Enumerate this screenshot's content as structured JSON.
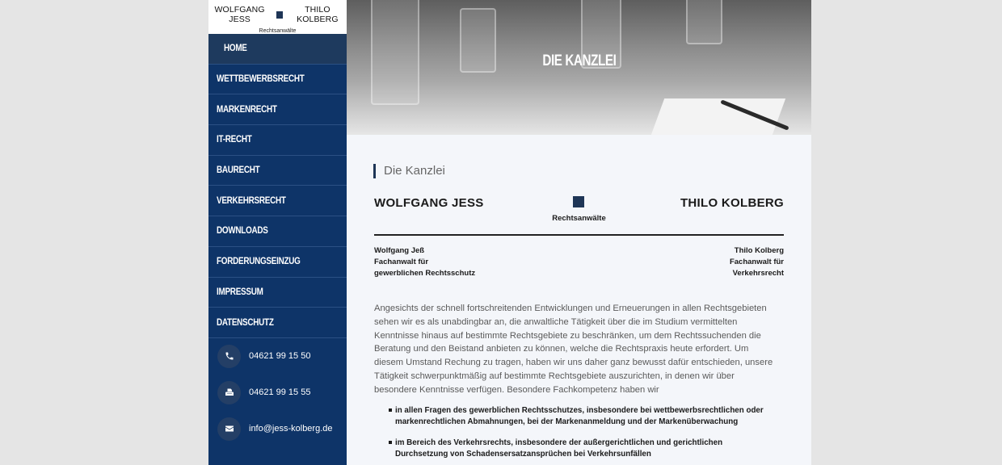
{
  "brand": {
    "left_name": "WOLFGANG JESS",
    "right_name": "THILO KOLBERG",
    "subtitle": "Rechtsanwälte"
  },
  "nav": [
    {
      "label": "HOME",
      "active": true
    },
    {
      "label": "WETTBEWERBSRECHT",
      "active": false
    },
    {
      "label": "MARKENRECHT",
      "active": false
    },
    {
      "label": "IT-RECHT",
      "active": false
    },
    {
      "label": "BAURECHT",
      "active": false
    },
    {
      "label": "VERKEHRSRECHT",
      "active": false
    },
    {
      "label": "DOWNLOADS",
      "active": false
    },
    {
      "label": "FORDERUNGSEINZUG",
      "active": false
    },
    {
      "label": "IMPRESSUM",
      "active": false
    },
    {
      "label": "DATENSCHUTZ",
      "active": false
    }
  ],
  "contacts": [
    {
      "icon": "phone-icon",
      "text": "04621 99 15 50"
    },
    {
      "icon": "fax-icon",
      "text": "04621 99 15 55"
    },
    {
      "icon": "mail-icon",
      "text": "info@jess-kolberg.de"
    }
  ],
  "hero": {
    "title": "DIE KANZLEI"
  },
  "content": {
    "section_title": "Die Kanzlei",
    "letterhead": {
      "left": "WOLFGANG JESS",
      "right": "THILO KOLBERG",
      "subtitle": "Rechtsanwälte"
    },
    "person_left": [
      "Wolfgang Jeß",
      "Fachanwalt für",
      "gewerblichen Rechtsschutz"
    ],
    "person_right": [
      "Thilo Kolberg",
      "Fachanwalt für",
      "Verkehrsrecht"
    ],
    "intro": "Angesichts der schnell fortschreitenden Entwicklungen und Erneuerungen in allen Rechtsgebieten sehen wir es als unabdingbar an, die anwaltliche Tätigkeit über die im Studium vermittelten Kenntnisse hinaus auf bestimmte Rechtsgebiete zu beschränken, um dem Rechtssuchenden die Beratung und den Beistand anbieten zu können, welche die Rechtspraxis heute erfordert. Um diesem Umstand Rechung zu tragen, haben wir uns daher ganz bewusst dafür entschieden, unsere Tätigkeit schwerpunktmäßig auf bestimmte Rechtsgebiete auszurichten, in denen wir über besondere Kenntnisse verfügen. Besondere Fachkompetenz haben wir",
    "bullets": [
      "in allen Fragen des gewerblichen Rechtsschutzes, insbesondere bei wettbewerbsrechtlichen oder markenrechtlichen Abmahnungen, bei der Markenanmeldung und der Markenüberwachung",
      "im Bereich des Verkehrsrechts, insbesondere der außergerichtlichen und gerichtlichen Durchsetzung von Schadensersatzansprüchen bei Verkehrsunfällen"
    ]
  }
}
